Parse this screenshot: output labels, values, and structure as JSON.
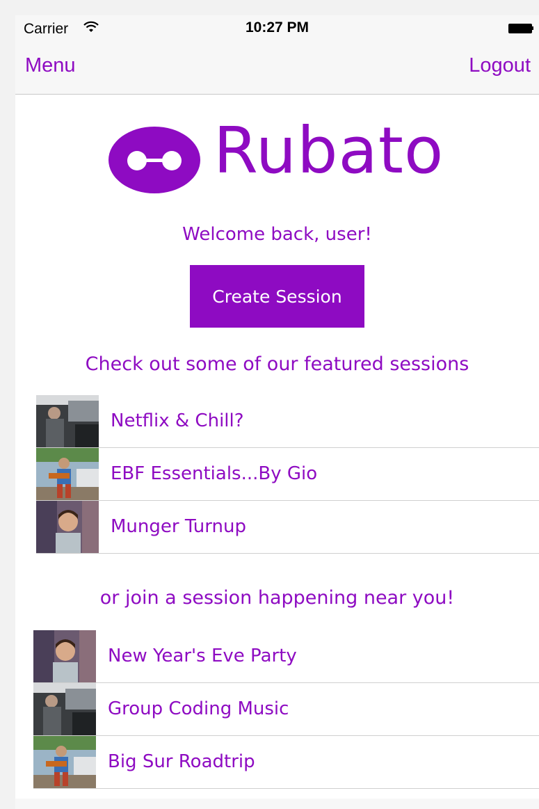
{
  "status_bar": {
    "carrier": "Carrier",
    "time": "10:27 PM",
    "wifi_icon": "wifi-icon",
    "battery_icon": "battery-full-icon"
  },
  "nav": {
    "left_label": "Menu",
    "right_label": "Logout"
  },
  "logo": {
    "text": "Rubato",
    "mark_icon": "rubato-logo-icon"
  },
  "welcome": "Welcome back, user!",
  "create_button": "Create Session",
  "featured": {
    "title": "Check out some of our featured sessions",
    "items": [
      {
        "label": "Netflix & Chill?",
        "thumb": "airplane-cockpit-thumbnail"
      },
      {
        "label": "EBF Essentials...By Gio",
        "thumb": "guitarist-thumbnail"
      },
      {
        "label": "Munger Turnup",
        "thumb": "smiling-person-thumbnail"
      }
    ]
  },
  "nearby": {
    "title": "or join a session happening near you!",
    "items": [
      {
        "label": "New Year's Eve Party",
        "thumb": "smiling-person-thumbnail"
      },
      {
        "label": "Group Coding Music",
        "thumb": "airplane-cockpit-thumbnail"
      },
      {
        "label": "Big Sur Roadtrip",
        "thumb": "guitarist-thumbnail"
      }
    ]
  },
  "colors": {
    "brand": "#8e0bc2",
    "nav_bg": "#f7f7f7"
  }
}
